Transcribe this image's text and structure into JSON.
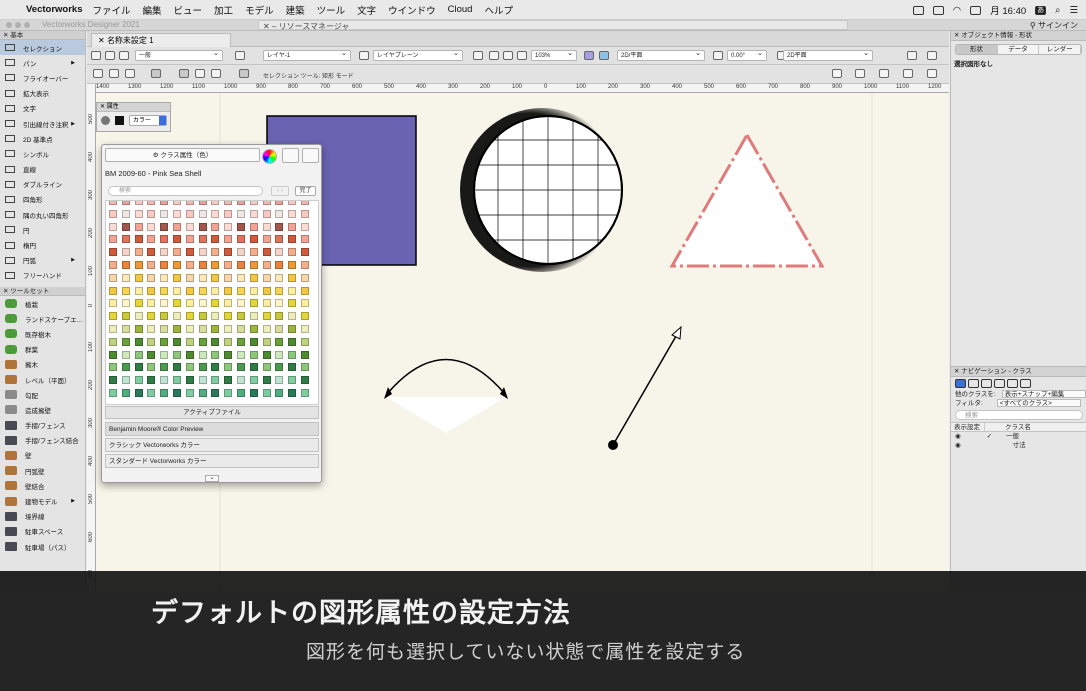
{
  "menubar": {
    "apple_icon": "apple-icon",
    "app_name": "Vectorworks",
    "items": [
      "ファイル",
      "編集",
      "ビュー",
      "加工",
      "モデル",
      "建築",
      "ツール",
      "文字",
      "ウインドウ",
      "Cloud",
      "ヘルプ"
    ],
    "clock": "月 16:40",
    "ime": "あ"
  },
  "window": {
    "app_title": "Vectorworks Designer 2021",
    "resource_manager": "リソースマネージャ",
    "sign_in": "サインイン",
    "doc_tab": "名称未設定 1"
  },
  "tool_palette": {
    "basic_header": "基本",
    "basic_tools": [
      {
        "label": "セレクション",
        "icon": "pointer-icon",
        "selected": true
      },
      {
        "label": "パン",
        "icon": "hand-icon",
        "has_submenu": true
      },
      {
        "label": "フライオーバー",
        "icon": "flyover-icon"
      },
      {
        "label": "拡大表示",
        "icon": "zoom-icon"
      },
      {
        "label": "文字",
        "icon": "text-icon"
      },
      {
        "label": "引出線付き注釈",
        "icon": "callout-icon",
        "has_submenu": true
      },
      {
        "label": "2D 基準点",
        "icon": "locus-icon"
      },
      {
        "label": "シンボル",
        "icon": "symbol-icon"
      },
      {
        "label": "直線",
        "icon": "line-icon"
      },
      {
        "label": "ダブルライン",
        "icon": "double-line-icon"
      },
      {
        "label": "四角形",
        "icon": "rectangle-icon"
      },
      {
        "label": "隅の丸い四角形",
        "icon": "rounded-rect-icon"
      },
      {
        "label": "円",
        "icon": "circle-icon"
      },
      {
        "label": "楕円",
        "icon": "oval-icon"
      },
      {
        "label": "円弧",
        "icon": "arc-icon",
        "has_submenu": true
      },
      {
        "label": "フリーハンド",
        "icon": "freehand-icon"
      }
    ],
    "toolset_header": "ツールセット",
    "toolsets": [
      {
        "label": "植栽",
        "icon": "plant-icon"
      },
      {
        "label": "ランドスケープエ…",
        "icon": "landscape-icon"
      },
      {
        "label": "既存樹木",
        "icon": "tree-icon"
      },
      {
        "label": "群葉",
        "icon": "foliage-icon"
      },
      {
        "label": "擁木",
        "icon": "shrub-icon"
      },
      {
        "label": "レベル（平面）",
        "icon": "level-icon"
      },
      {
        "label": "勾配",
        "icon": "slope-icon"
      },
      {
        "label": "造成擁壁",
        "icon": "retaining-wall-icon"
      },
      {
        "label": "手摺/フェンス",
        "icon": "railing-icon"
      },
      {
        "label": "手摺/フェンス結合",
        "icon": "railing-join-icon"
      },
      {
        "label": "壁",
        "icon": "wall-icon"
      },
      {
        "label": "円弧壁",
        "icon": "round-wall-icon"
      },
      {
        "label": "壁結合",
        "icon": "wall-join-icon"
      },
      {
        "label": "建物モデル",
        "icon": "building-icon",
        "has_submenu": true
      },
      {
        "label": "境界線",
        "icon": "boundary-icon"
      },
      {
        "label": "駐車スペース",
        "icon": "parking-icon"
      },
      {
        "label": "駐車場（パス）",
        "icon": "parking-path-icon"
      }
    ]
  },
  "toolbar": {
    "class_select": "一般",
    "layer_select": "レイヤ-1",
    "layer_plane": "レイヤプレーン",
    "zoom": "103%",
    "view": "2D/平面",
    "rotation": "0.00°",
    "plane": "2D平面",
    "mode_label": "セレクション ツール: 矩形 モード"
  },
  "ruler": {
    "h_ticks": [
      "1400",
      "1300",
      "1200",
      "1100",
      "1000",
      "900",
      "800",
      "700",
      "600",
      "500",
      "400",
      "300",
      "200",
      "100",
      "0",
      "100",
      "200",
      "300",
      "400",
      "500",
      "600",
      "700",
      "800",
      "900",
      "1000",
      "1100",
      "1200"
    ],
    "v_ticks": [
      "500",
      "400",
      "300",
      "200",
      "100",
      "0",
      "100",
      "200",
      "300",
      "400",
      "500",
      "600",
      "700"
    ]
  },
  "attributes_palette": {
    "title": "属性",
    "fill_type": "カラー"
  },
  "color_popup": {
    "header": "クラス属性（色）",
    "selected_color": "BM 2009-60 - Pink Sea Shell",
    "search_placeholder": "検索",
    "done": "完了",
    "active_file": "アクティブファイル",
    "libraries": [
      "Benjamin Moore® Color Preview",
      "クラシック Vectorworks カラー",
      "スタンダード Vectorworks カラー"
    ],
    "swatch_colors": [
      "#f3b7b2",
      "#e7a29b",
      "#f7c9c3",
      "#efe7e4",
      "#fbdad4",
      "#a2574d",
      "#f3a394",
      "#e0735b",
      "#cf5a3c",
      "#f5d3c6",
      "#f4ae8b",
      "#e9843e",
      "#ec9936",
      "#f7d7a7",
      "#fbe9b8",
      "#f2c842",
      "#f5d552",
      "#fdeea0",
      "#fff5c9",
      "#e3d63b",
      "#c7c93a",
      "#eeeebb",
      "#d8dc9c",
      "#9db43f",
      "#bed27f",
      "#6aa13a",
      "#4e8a2f",
      "#cde8bd",
      "#8ec77c",
      "#4c9a52",
      "#2f7d45",
      "#bde5cf",
      "#7ecca0",
      "#51ac80",
      "#2a7a5a"
    ],
    "accent": "#6a63b2"
  },
  "right_panel": {
    "info_title": "オブジェクト情報 - 形状",
    "tabs": [
      "形状",
      "データ",
      "レンダー"
    ],
    "no_selection": "選択図形なし",
    "navigation_title": "ナビゲーション - クラス",
    "other_classes_label": "他のクラスを:",
    "other_classes_value": "表示+スナップ+編集",
    "filter_label": "フィルタ:",
    "filter_value": "<すべてのクラス>",
    "search_placeholder": "検索",
    "col_visibility": "表示設定",
    "col_name": "クラス名",
    "classes": [
      "一般",
      "寸法"
    ]
  },
  "canvas_colors": {
    "rect_fill": "#6a63b2",
    "triangle_stroke": "#e07b7b",
    "background": "#f7f5ea"
  },
  "caption": {
    "title": "デフォルトの図形属性の設定方法",
    "subtitle": "図形を何も選択していない状態で属性を設定する"
  }
}
